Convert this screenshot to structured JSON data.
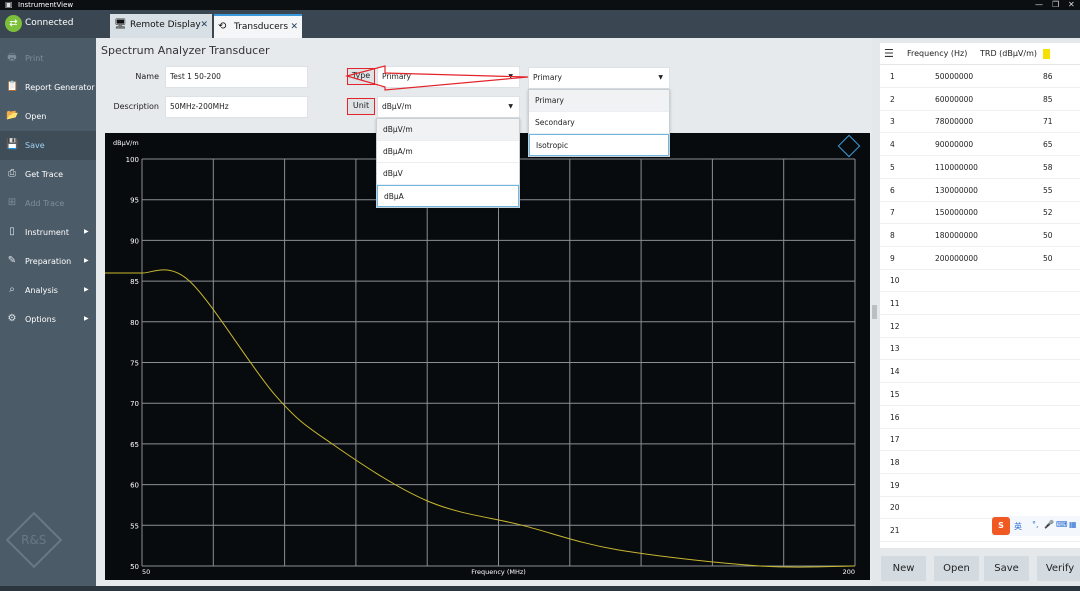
{
  "app": {
    "title": "InstrumentView",
    "status": "Connected"
  },
  "sidebar": {
    "items": [
      {
        "label": "Print",
        "icon": "print-icon",
        "disabled": true
      },
      {
        "label": "Report Generator",
        "icon": "report-icon"
      },
      {
        "label": "Open",
        "icon": "open-icon"
      },
      {
        "label": "Save",
        "icon": "save-icon",
        "active": true
      },
      {
        "label": "Get Trace",
        "icon": "get-trace-icon"
      },
      {
        "label": "Add Trace",
        "icon": "add-trace-icon",
        "disabled": true
      },
      {
        "label": "Instrument",
        "icon": "instrument-icon",
        "submenu": true
      },
      {
        "label": "Preparation",
        "icon": "pencil-icon",
        "submenu": true
      },
      {
        "label": "Analysis",
        "icon": "analysis-icon",
        "submenu": true
      },
      {
        "label": "Options",
        "icon": "gear-icon",
        "submenu": true
      }
    ],
    "logo": "R&S"
  },
  "tabs": [
    {
      "label": "Remote Display"
    },
    {
      "label": "Transducers",
      "active": true
    }
  ],
  "form": {
    "title": "Spectrum Analyzer Transducer",
    "name_label": "Name",
    "name_value": "Test 1 50-200",
    "description_label": "Description",
    "description_value": "50MHz-200MHz",
    "type_label": "Type",
    "type_value": "Primary",
    "unit_label": "Unit",
    "unit_value": "dBµV/m",
    "unit_options": [
      "dBµV/m",
      "dBµA/m",
      "dBµV",
      "dBµA"
    ],
    "type_dropdown_value": "Primary",
    "type_options": [
      "Primary",
      "Secondary",
      "Isotropic"
    ]
  },
  "table": {
    "headers": [
      "Frequency (Hz)",
      "TRD (dBµV/m)"
    ],
    "rows": [
      {
        "n": "1",
        "f": "50000000",
        "v": "86"
      },
      {
        "n": "2",
        "f": "60000000",
        "v": "85"
      },
      {
        "n": "3",
        "f": "78000000",
        "v": "71"
      },
      {
        "n": "4",
        "f": "90000000",
        "v": "65"
      },
      {
        "n": "5",
        "f": "110000000",
        "v": "58"
      },
      {
        "n": "6",
        "f": "130000000",
        "v": "55"
      },
      {
        "n": "7",
        "f": "150000000",
        "v": "52"
      },
      {
        "n": "8",
        "f": "180000000",
        "v": "50"
      },
      {
        "n": "9",
        "f": "200000000",
        "v": "50"
      },
      {
        "n": "10",
        "f": "",
        "v": ""
      },
      {
        "n": "11",
        "f": "",
        "v": ""
      },
      {
        "n": "12",
        "f": "",
        "v": ""
      },
      {
        "n": "13",
        "f": "",
        "v": ""
      },
      {
        "n": "14",
        "f": "",
        "v": ""
      },
      {
        "n": "15",
        "f": "",
        "v": ""
      },
      {
        "n": "16",
        "f": "",
        "v": ""
      },
      {
        "n": "17",
        "f": "",
        "v": ""
      },
      {
        "n": "18",
        "f": "",
        "v": ""
      },
      {
        "n": "19",
        "f": "",
        "v": ""
      },
      {
        "n": "20",
        "f": "",
        "v": ""
      },
      {
        "n": "21",
        "f": "",
        "v": ""
      }
    ],
    "buttons": [
      "New",
      "Open",
      "Save",
      "Verify"
    ]
  },
  "ime": {
    "label": "英"
  },
  "colors": {
    "trace": "#c8b830",
    "accent": "#3a9ad9",
    "highlight": "#e3242b"
  },
  "chart_data": {
    "type": "line",
    "ylabel": "dBµV/m",
    "xlabel": "Frequency (MHz)",
    "xlim": [
      50,
      200
    ],
    "ylim": [
      50,
      100
    ],
    "x_tick_labels": [
      "50",
      "200"
    ],
    "y_ticks": [
      100,
      95,
      90,
      85,
      80,
      75,
      70,
      65,
      60,
      55,
      50
    ],
    "grid": true,
    "series": [
      {
        "x": [
          50,
          60,
          78,
          90,
          110,
          130,
          150,
          180,
          200
        ],
        "y": [
          86,
          85,
          71,
          65,
          58,
          55,
          52,
          50,
          50
        ]
      }
    ]
  }
}
